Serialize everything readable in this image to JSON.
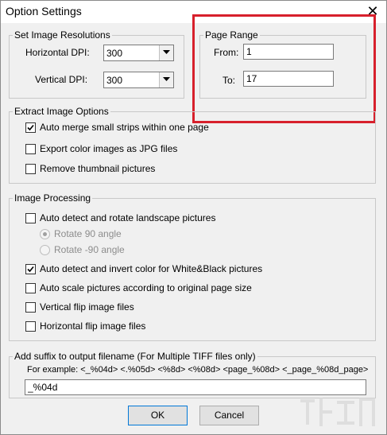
{
  "window": {
    "title": "Option Settings",
    "close_glyph": "✕"
  },
  "resolution": {
    "legend": "Set Image Resolutions",
    "horizontal_label": "Horizontal DPI:",
    "horizontal_value": "300",
    "vertical_label": "Vertical DPI:",
    "vertical_value": "300"
  },
  "page_range": {
    "legend": "Page Range",
    "from_label": "From:",
    "from_value": "1",
    "to_label": "To:",
    "to_value": "17"
  },
  "extract": {
    "legend": "Extract Image Options",
    "options": [
      {
        "label": "Auto merge small strips within one page",
        "checked": true
      },
      {
        "label": "Export color images as JPG files",
        "checked": false
      },
      {
        "label": "Remove thumbnail pictures",
        "checked": false
      }
    ]
  },
  "processing": {
    "legend": "Image Processing",
    "auto_rotate": {
      "label": "Auto detect and rotate landscape pictures",
      "checked": false
    },
    "radios": [
      {
        "label": "Rotate 90 angle",
        "selected": true,
        "disabled": true
      },
      {
        "label": "Rotate -90 angle",
        "selected": false,
        "disabled": true
      }
    ],
    "options": [
      {
        "label": "Auto detect and invert color for White&Black pictures",
        "checked": true
      },
      {
        "label": "Auto scale pictures according to original page size",
        "checked": false
      },
      {
        "label": "Vertical flip image files",
        "checked": false
      },
      {
        "label": "Horizontal flip image files",
        "checked": false
      }
    ]
  },
  "suffix": {
    "legend": "Add suffix to output filename (For Multiple TIFF files only)",
    "example": "For example: <_%04d> <.%05d> <%8d> <%08d> <page_%08d> <_page_%08d_page>",
    "value": "_%04d"
  },
  "buttons": {
    "ok": "OK",
    "cancel": "Cancel"
  },
  "colors": {
    "highlight": "#d7202c",
    "focus": "#0078d7"
  }
}
